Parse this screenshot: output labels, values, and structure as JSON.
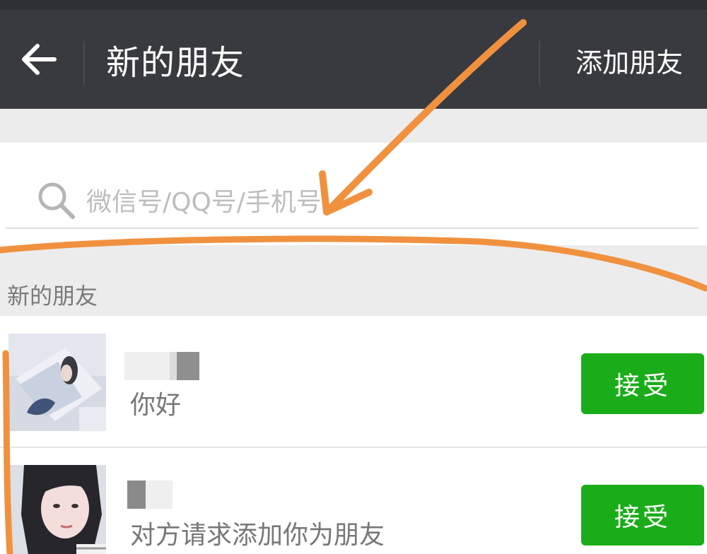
{
  "navbar": {
    "back_icon": "arrow-left-icon",
    "title": "新的朋友",
    "add_friend_label": "添加朋友"
  },
  "search": {
    "icon": "search-icon",
    "placeholder": "微信号/QQ号/手机号"
  },
  "section": {
    "title": "新的朋友"
  },
  "requests": [
    {
      "name": "",
      "message": "你好",
      "action_label": "接受"
    },
    {
      "name": "",
      "message": "对方请求添加你为朋友",
      "action_label": "接受"
    }
  ],
  "colors": {
    "navbar_bg": "#393a3f",
    "accept_green": "#1aad19",
    "annotation_orange": "#f0913f"
  }
}
